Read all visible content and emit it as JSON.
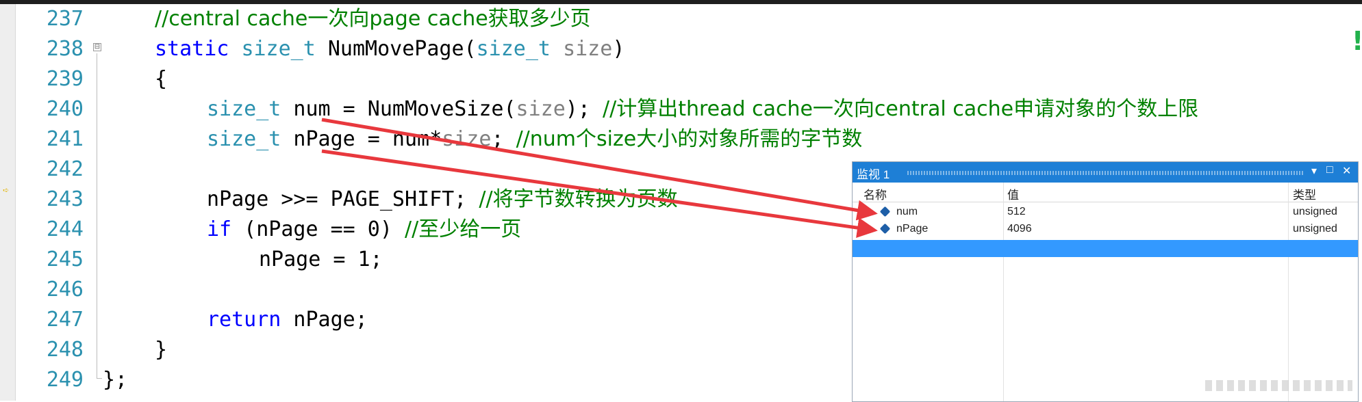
{
  "editor": {
    "line_numbers": [
      "237",
      "238",
      "239",
      "240",
      "241",
      "242",
      "243",
      "244",
      "245",
      "246",
      "247",
      "248",
      "249"
    ],
    "lines": {
      "l237": {
        "comment": "//central cache一次向page cache获取多少页"
      },
      "l238": {
        "kw_static": "static",
        "type_size_t": "size_t",
        "func": " NumMovePage(",
        "type_param": "size_t",
        "param": "size",
        "close": ")"
      },
      "l239": {
        "text": "{"
      },
      "l240": {
        "type": "size_t",
        "decl": " num = NumMoveSize(",
        "arg": "size",
        "close": "); ",
        "comment": "//计算出thread cache一次向central cache申请对象的个数上限"
      },
      "l241": {
        "type": "size_t",
        "decl": " nPage = num*",
        "arg": "size",
        "close": "; ",
        "comment": "//num个size大小的对象所需的字节数"
      },
      "l242": {
        "text": ""
      },
      "l243": {
        "stmt": "nPage >>= PAGE_SHIFT; ",
        "comment": "//将字节数转换为页数"
      },
      "l244": {
        "kw_if": "if",
        "cond": " (nPage == 0) ",
        "comment": "//至少给一页"
      },
      "l245": {
        "stmt": "nPage = 1;"
      },
      "l246": {
        "text": ""
      },
      "l247": {
        "kw_return": "return",
        "rest": " nPage;"
      },
      "l248": {
        "text": "}"
      },
      "l249": {
        "text": "};"
      }
    },
    "fold_glyph": "⊟",
    "breakpoint_glyph": "➪",
    "right_mark": "!"
  },
  "watch_window": {
    "title": "监视 1",
    "controls": {
      "dropdown": "▾",
      "maximize": "□",
      "close": "✕"
    },
    "columns": {
      "name": "名称",
      "value": "值",
      "type": "类型"
    },
    "rows": [
      {
        "name": "num",
        "value": "512",
        "type": "unsigned"
      },
      {
        "name": "nPage",
        "value": "4096",
        "type": "unsigned"
      }
    ]
  },
  "colors": {
    "line_number": "#2b91af",
    "comment": "#008000",
    "keyword": "#0000ff",
    "type": "#2b91af",
    "watch_title": "#1e7fd6",
    "selection": "#3399ff",
    "arrow": "#e8383d"
  }
}
